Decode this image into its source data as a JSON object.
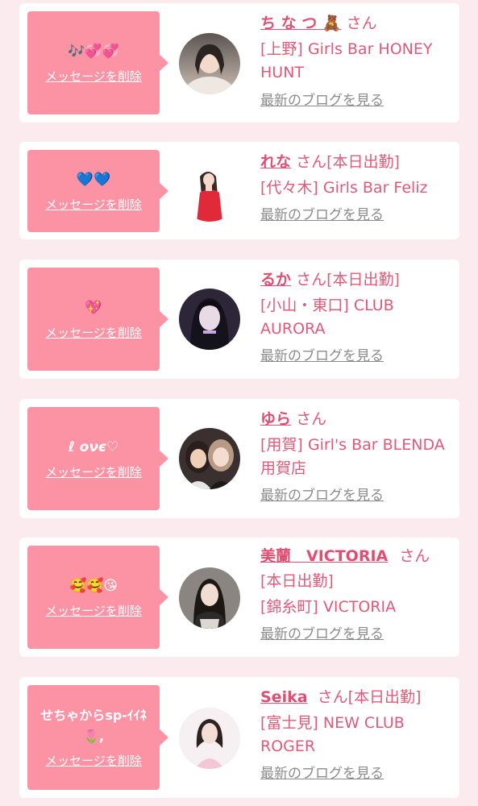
{
  "delete_label": "メッセージを削除",
  "blog_label": "最新のブログを見る",
  "cards": [
    {
      "message": "🎶💞💞",
      "name": "ち な つ 🧸",
      "honor_inline": "さん",
      "status_line": "",
      "shop": "[上野] Girls Bar HONEY HUNT"
    },
    {
      "message": "💙💙",
      "name": "れな",
      "honor_inline": "さん[本日出勤]",
      "status_line": "",
      "shop": "[代々木] Girls Bar Feliz"
    },
    {
      "message": "💖",
      "name": "るか",
      "honor_inline": "さん[本日出勤]",
      "status_line": "",
      "shop": "[小山・東口] CLUB AURORA"
    },
    {
      "message": "ℓ ονє♡",
      "name": "ゆら",
      "honor_inline": "さん",
      "status_line": "",
      "shop": "[用賀] Girl's Bar BLENDA 用賀店"
    },
    {
      "message": "🥰🥰😘",
      "name": "美蘭　VICTORIA",
      "honor_inline": "さん",
      "status_line": "[本日出勤]",
      "shop": "[錦糸町] VICTORIA"
    },
    {
      "message": "せちゃからsp-ｲｲﾈ🌷,",
      "name": "Seika",
      "honor_inline": "さん[本日出勤]",
      "status_line": "",
      "shop": "[富士見] NEW CLUB ROGER"
    }
  ]
}
